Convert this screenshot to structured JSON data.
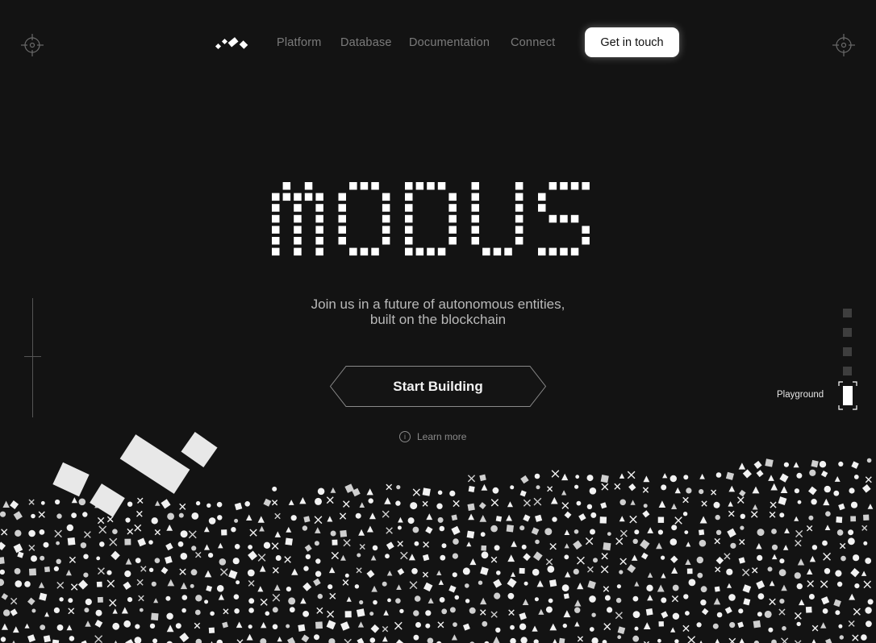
{
  "nav": {
    "links": [
      {
        "label": "Platform"
      },
      {
        "label": "Database"
      },
      {
        "label": "Documentation"
      },
      {
        "label": "Connect"
      }
    ],
    "cta_label": "Get in touch"
  },
  "hero": {
    "logotype": "MODUS",
    "tagline_line1": "Join us in a future of autonomous entities,",
    "tagline_line2": "built on the blockchain",
    "primary_button": "Start Building",
    "learn_more": "Learn more",
    "learn_more_icon": "i"
  },
  "side_nav": {
    "items_count": 4,
    "active_label": "Playground"
  },
  "colors": {
    "background": "#131313",
    "text": "#ffffff",
    "muted_link": "#7b7b7b",
    "tagline": "#b9b9b9",
    "dot_inactive": "#3e3e3e"
  },
  "icons": [
    "logo-mark",
    "crosshair-icon",
    "info-icon"
  ]
}
